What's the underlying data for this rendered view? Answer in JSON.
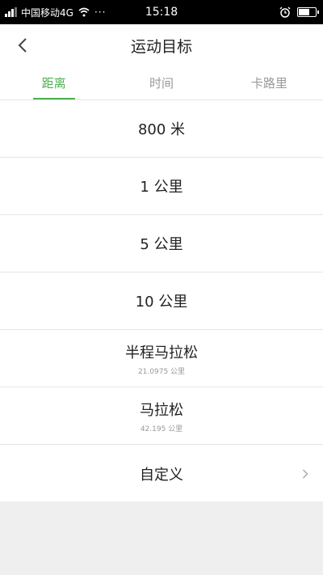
{
  "status_bar": {
    "carrier": "中国移动4G",
    "dots": "···",
    "time": "15:18"
  },
  "header": {
    "title": "运动目标"
  },
  "tabs": [
    {
      "label": "距离",
      "active": true
    },
    {
      "label": "时间",
      "active": false
    },
    {
      "label": "卡路里",
      "active": false
    }
  ],
  "options": [
    {
      "label": "800 米",
      "sub": ""
    },
    {
      "label": "1 公里",
      "sub": ""
    },
    {
      "label": "5 公里",
      "sub": ""
    },
    {
      "label": "10 公里",
      "sub": ""
    },
    {
      "label": "半程马拉松",
      "sub": "21.0975 公里"
    },
    {
      "label": "马拉松",
      "sub": "42.195 公里"
    },
    {
      "label": "自定义",
      "sub": ""
    }
  ],
  "colors": {
    "accent": "#4caf50",
    "status_bar": "#000000",
    "background": "#efefef"
  }
}
